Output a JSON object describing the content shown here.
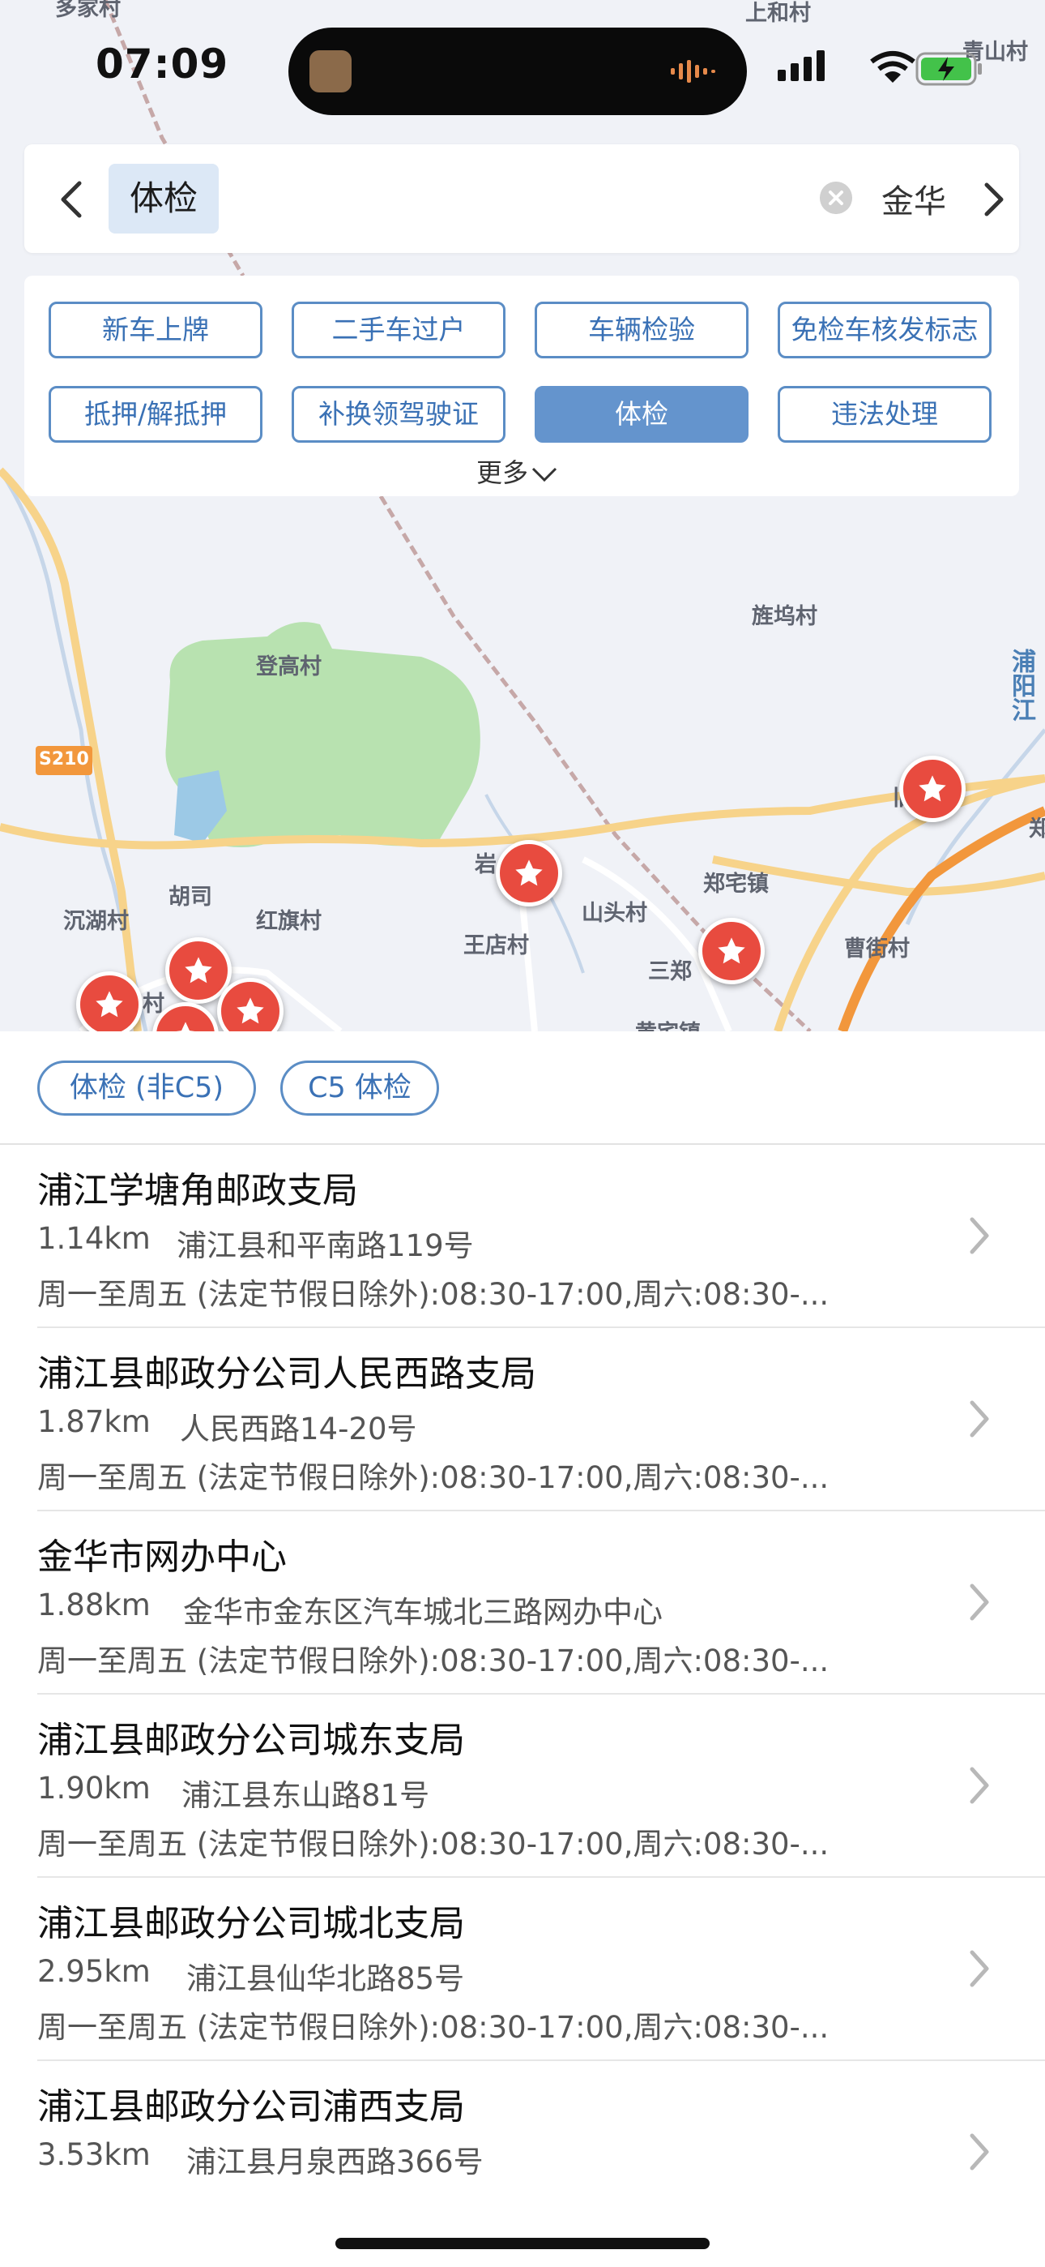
{
  "status_bar": {
    "time": "07:09"
  },
  "map": {
    "labels": {
      "l1": "登高村",
      "l2": "旌坞村",
      "l3": "浦阳江",
      "l4": "S210",
      "l5": "胡司",
      "l6": "沉湖村",
      "l7": "红旗村",
      "l8": "岩",
      "l9": "王店村",
      "l10": "山头村",
      "l11": "郑宅镇",
      "l12": "三郑",
      "l13": "曹街村",
      "l14": "村",
      "l15": "上和村",
      "l16": "青山村",
      "l17": "多家村",
      "l18": "郑",
      "l19": "旧",
      "l20": "黄宅镇"
    }
  },
  "search": {
    "query": "体检",
    "city": "金华"
  },
  "services": [
    "新车上牌",
    "二手车过户",
    "车辆检验",
    "免检车核发标志",
    "抵押/解抵押",
    "补换领驾驶证",
    "体检",
    "违法处理"
  ],
  "services_active": "体检",
  "more_label": "更多",
  "tabs": [
    "体检 (非C5)",
    "C5 体检"
  ],
  "locations": [
    {
      "name": "浦江学塘角邮政支局",
      "distance": "1.14km",
      "address": "浦江县和平南路119号",
      "hours": "周一至周五 (法定节假日除外):08:30-17:00,周六:08:30-..."
    },
    {
      "name": "浦江县邮政分公司人民西路支局",
      "distance": "1.87km",
      "address": "人民西路14-20号",
      "hours": "周一至周五 (法定节假日除外):08:30-17:00,周六:08:30-..."
    },
    {
      "name": "金华市网办中心",
      "distance": "1.88km",
      "address": "金华市金东区汽车城北三路网办中心",
      "hours": "周一至周五 (法定节假日除外):08:30-17:00,周六:08:30-..."
    },
    {
      "name": "浦江县邮政分公司城东支局",
      "distance": "1.90km",
      "address": "浦江县东山路81号",
      "hours": "周一至周五 (法定节假日除外):08:30-17:00,周六:08:30-..."
    },
    {
      "name": "浦江县邮政分公司城北支局",
      "distance": "2.95km",
      "address": "浦江县仙华北路85号",
      "hours": "周一至周五 (法定节假日除外):08:30-17:00,周六:08:30-..."
    },
    {
      "name": "浦江县邮政分公司浦西支局",
      "distance": "3.53km",
      "address": "浦江县月泉西路366号",
      "hours": ""
    }
  ],
  "colors": {
    "accent": "#6494cd",
    "pin": "#e84b3f",
    "road": "#f7d38a",
    "park": "#b8e2b0"
  }
}
